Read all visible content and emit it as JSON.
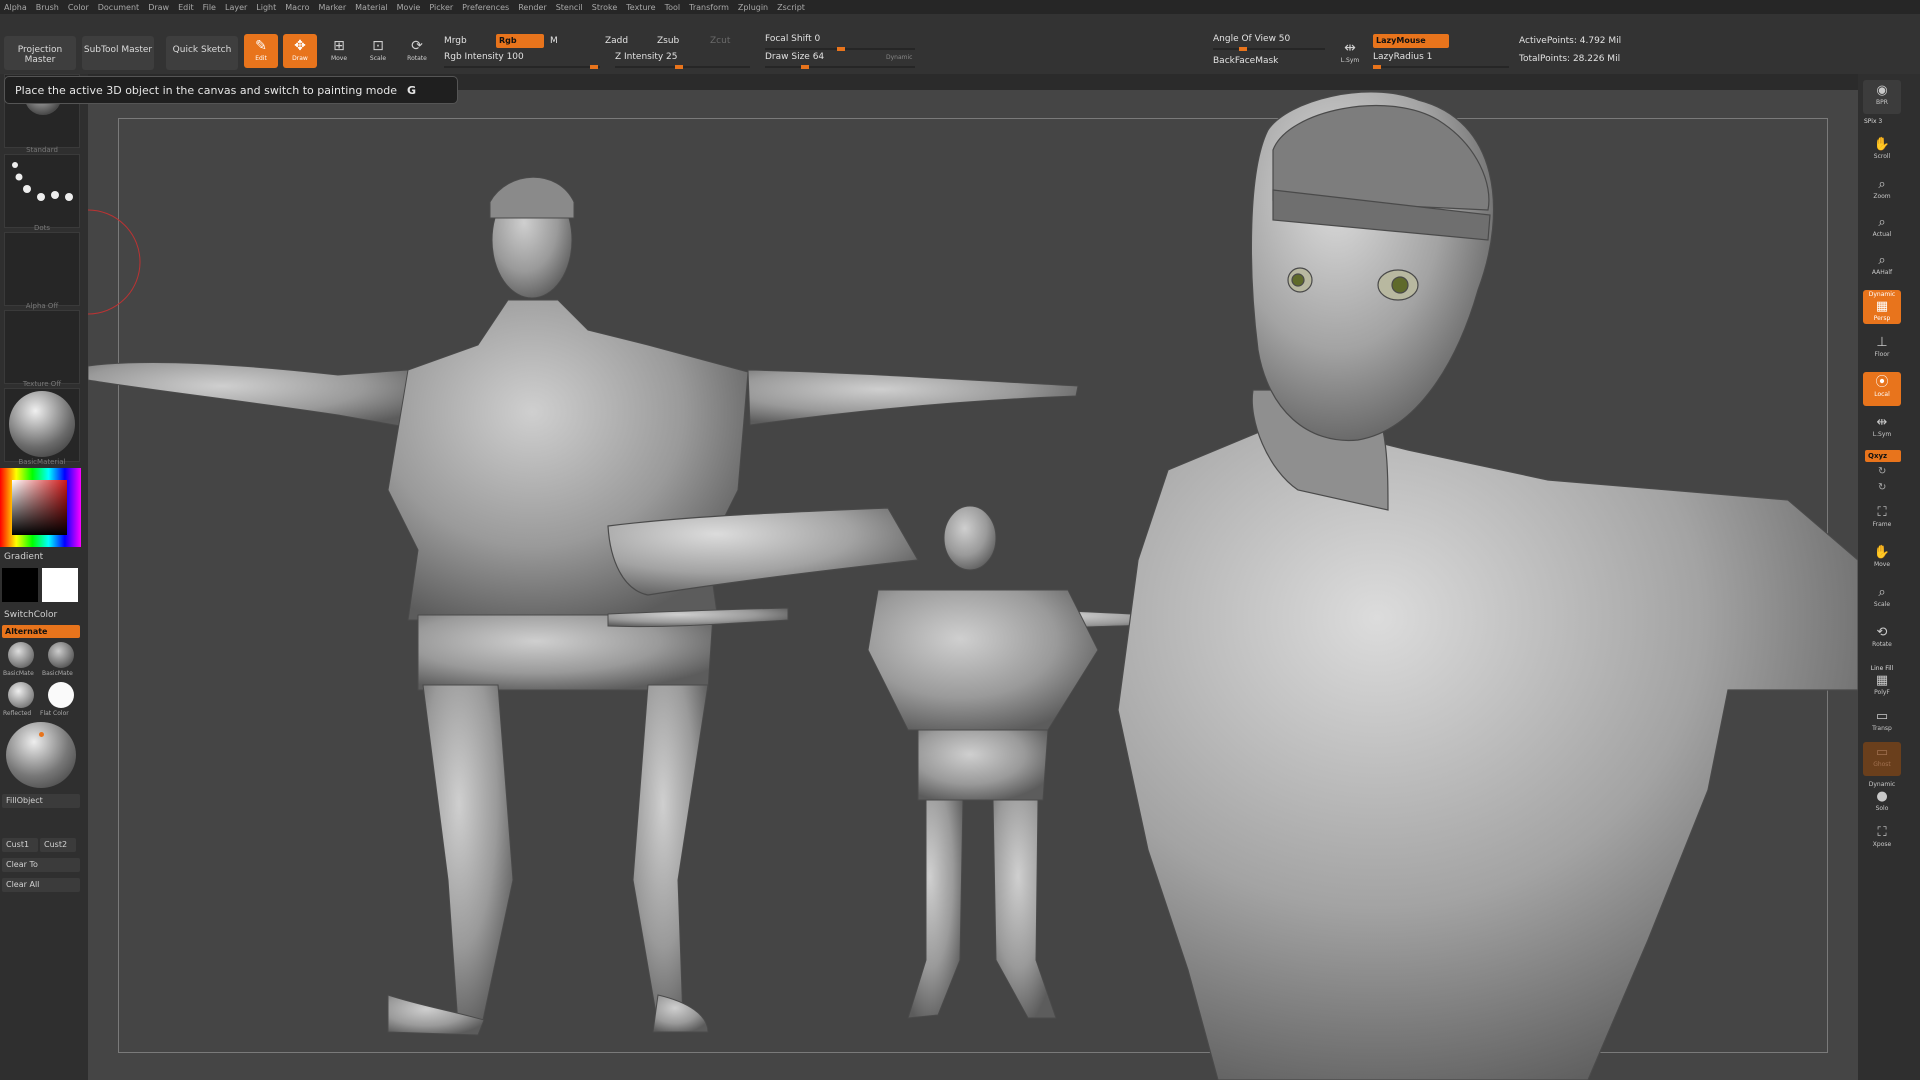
{
  "menu": [
    "Alpha",
    "Brush",
    "Color",
    "Document",
    "Draw",
    "Edit",
    "File",
    "Layer",
    "Light",
    "Macro",
    "Marker",
    "Material",
    "Movie",
    "Picker",
    "Preferences",
    "Render",
    "Stencil",
    "Stroke",
    "Texture",
    "Tool",
    "Transform",
    "Zplugin",
    "Zscript"
  ],
  "toolbar": {
    "projection_master": "Projection Master",
    "subtool_master": "SubTool Master",
    "quick_sketch": "Quick Sketch",
    "edit": "Edit",
    "draw": "Draw",
    "move": "Move",
    "scale": "Scale",
    "rotate": "Rotate",
    "mrgb": "Mrgb",
    "rgb": "Rgb",
    "m": "M",
    "zadd": "Zadd",
    "zsub": "Zsub",
    "zcut": "Zcut",
    "rgb_intensity": "Rgb Intensity 100",
    "z_intensity": "Z Intensity 25",
    "focal_shift": "Focal Shift 0",
    "draw_size": "Draw Size 64",
    "dynamic": "Dynamic",
    "angle_of_view": "Angle Of View 50",
    "backface_mask": "BackFaceMask",
    "lsym": "L.Sym",
    "lazymouse": "LazyMouse",
    "lazyradius": "LazyRadius 1",
    "active_points": "ActivePoints: 4.792 Mil",
    "total_points": "TotalPoints: 28.226 Mil"
  },
  "tooltip": {
    "text": "Place the active 3D object in the canvas and switch to painting mode",
    "hotkey": "G"
  },
  "left_shelf": {
    "brush_label": "Standard",
    "stroke_label": "Dots",
    "alpha_label": "Alpha Off",
    "texture_label": "Texture Off",
    "material_label": "BasicMaterial",
    "gradient": "Gradient",
    "switch_color": "SwitchColor",
    "alternate": "Alternate",
    "mat1": "BasicMate",
    "mat2": "BasicMate",
    "mat3": "Reflected",
    "mat4": "Flat Color",
    "fill_object": "FillObject",
    "cust1": "Cust1",
    "cust2": "Cust2",
    "clear_to": "Clear To",
    "clear_all": "Clear All"
  },
  "right_shelf": {
    "bpr": "BPR",
    "spix": "SPix 3",
    "scroll": "Scroll",
    "zoom": "Zoom",
    "actual": "Actual",
    "aahalf": "AAHalf",
    "dynamic": "Dynamic",
    "persp": "Persp",
    "floor": "Floor",
    "local": "Local",
    "lsym": "L.Sym",
    "xyz": "Qxyz",
    "frame": "Frame",
    "move": "Move",
    "scale": "Scale",
    "rotate": "Rotate",
    "line_fill": "Line Fill",
    "polyf": "PolyF",
    "transp": "Transp",
    "ghost": "Ghost",
    "dynamic2": "Dynamic",
    "solo": "Solo",
    "xpose": "Xpose"
  },
  "colors": {
    "accent": "#e8741c",
    "canvas": "#454545",
    "ui": "#333333"
  }
}
